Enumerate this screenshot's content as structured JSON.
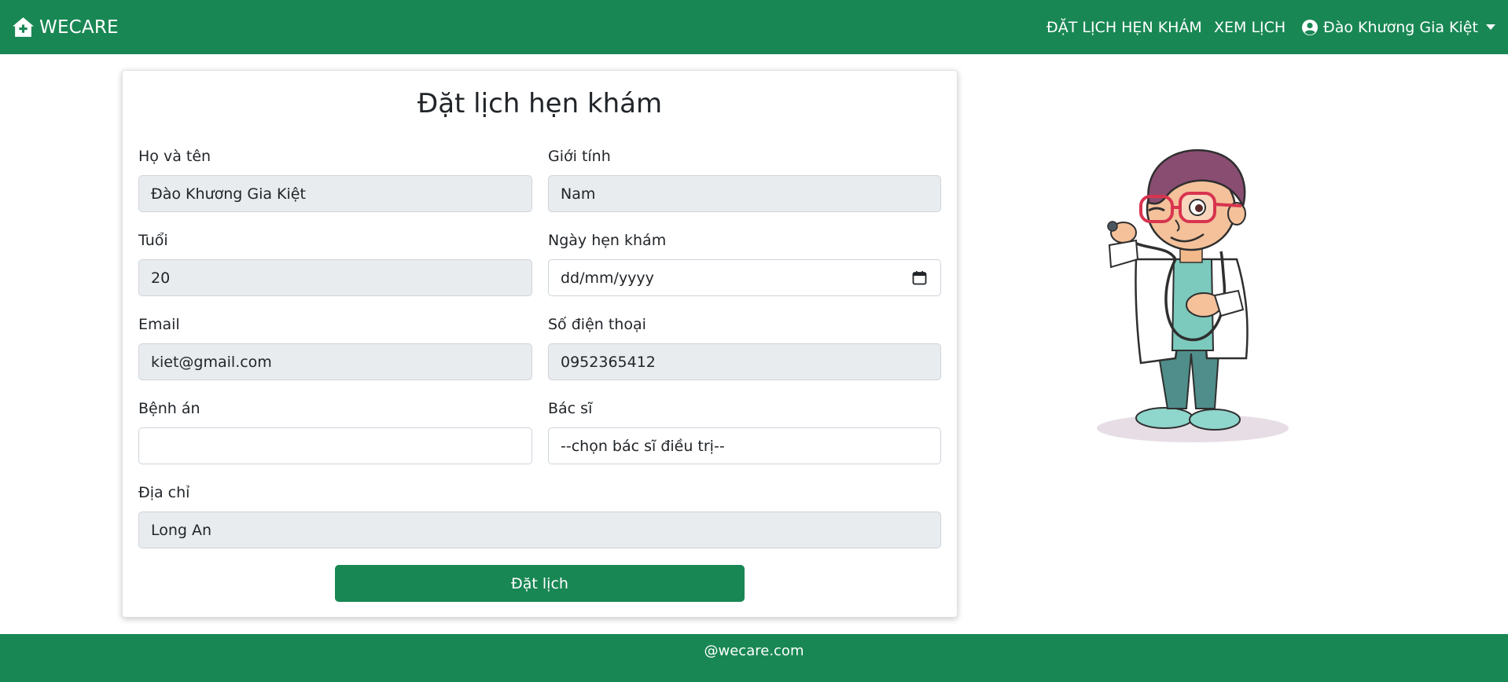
{
  "navbar": {
    "brand": "WECARE",
    "brand_icon": "home-plus-icon",
    "links": {
      "book": "ĐẶT LỊCH HẸN KHÁM",
      "view": "XEM LỊCH"
    },
    "user": {
      "name": "Đào Khương Gia Kiệt",
      "icon": "user-circle-icon"
    }
  },
  "form": {
    "title": "Đặt lịch hẹn khám",
    "fields": {
      "fullname": {
        "label": "Họ và tên",
        "value": "Đào Khương Gia Kiệt"
      },
      "gender": {
        "label": "Giới tính",
        "value": "Nam"
      },
      "age": {
        "label": "Tuổi",
        "value": "20"
      },
      "date": {
        "label": "Ngày hẹn khám",
        "value": "dd/mm/yyyy"
      },
      "email": {
        "label": "Email",
        "value": "kiet@gmail.com"
      },
      "phone": {
        "label": "Số điện thoại",
        "value": "0952365412"
      },
      "record": {
        "label": "Bệnh án",
        "value": ""
      },
      "doctor": {
        "label": "Bác sĩ",
        "value": "--chọn bác sĩ điều trị--"
      },
      "address": {
        "label": "Địa chỉ",
        "value": "Long An"
      }
    },
    "submit_label": "Đặt lịch"
  },
  "footer": {
    "text": "@wecare.com"
  },
  "colors": {
    "primary": "#198754",
    "disabled_bg": "#e9ecef",
    "border": "#ced4da"
  }
}
